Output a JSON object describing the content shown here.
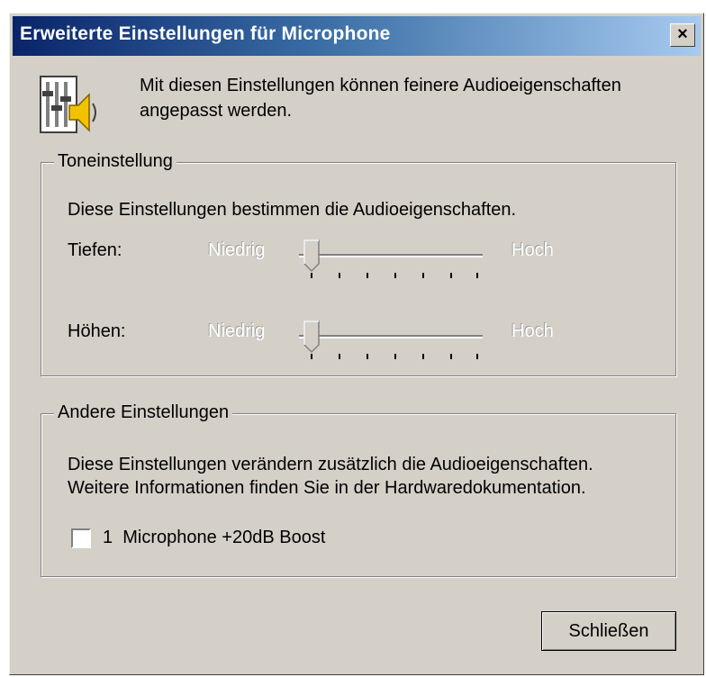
{
  "window": {
    "title": "Erweiterte Einstellungen für Microphone",
    "close_label": "×"
  },
  "intro": {
    "icon": "audio-settings-icon",
    "text": "Mit diesen Einstellungen können feinere Audioeigenschaften angepasst werden."
  },
  "tone": {
    "group_title": "Toneinstellung",
    "description": "Diese Einstellungen bestimmen die Audioeigenschaften.",
    "bass": {
      "label": "Tiefen:",
      "low": "Niedrig",
      "high": "Hoch",
      "level": 0,
      "enabled": false
    },
    "treble": {
      "label": "Höhen:",
      "low": "Niedrig",
      "high": "Hoch",
      "level": 0,
      "enabled": false
    }
  },
  "other": {
    "group_title": "Andere Einstellungen",
    "description_line1": "Diese Einstellungen verändern zusätzlich die Audioeigenschaften.",
    "description_line2": "Weitere Informationen finden Sie in der Hardwaredokumentation.",
    "boost_label": "1  Microphone +20dB Boost",
    "boost_checked": false
  },
  "buttons": {
    "close_label": "Schließen"
  },
  "colors": {
    "titlebar_start": "#0a246a",
    "titlebar_end": "#a6caf0",
    "face": "#d4d0c8"
  }
}
